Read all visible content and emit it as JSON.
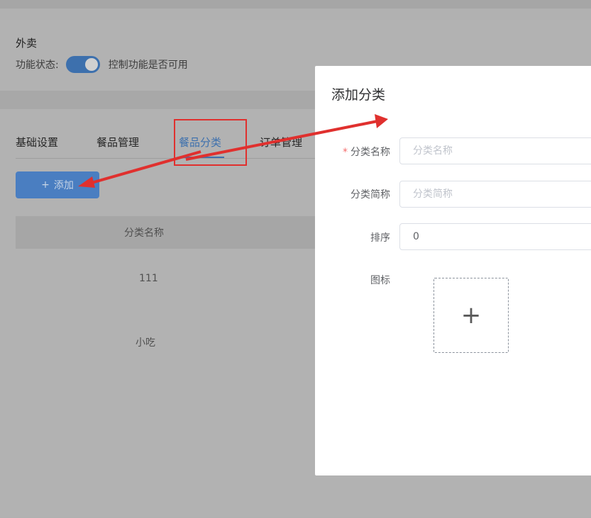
{
  "header": {
    "app_title": "外卖",
    "status_label": "功能状态:",
    "toggle_enabled": true,
    "toggle_hint": "控制功能是否可用"
  },
  "tabs": [
    {
      "label": "基础设置",
      "active": false
    },
    {
      "label": "餐品管理",
      "active": false
    },
    {
      "label": "餐品分类",
      "active": true
    },
    {
      "label": "订单管理",
      "active": false
    }
  ],
  "toolbar": {
    "add_label": "添加",
    "add_icon": "plus-icon"
  },
  "table": {
    "columns": [
      "分类名称"
    ],
    "rows": [
      {
        "name": "111"
      },
      {
        "name": "小吃"
      }
    ]
  },
  "dialog": {
    "title": "添加分类",
    "fields": {
      "name": {
        "label": "分类名称",
        "required": true,
        "value": "",
        "placeholder": "分类名称"
      },
      "short_name": {
        "label": "分类简称",
        "value": "",
        "placeholder": "分类简称"
      },
      "sort": {
        "label": "排序",
        "value": "0"
      },
      "icon": {
        "label": "图标",
        "upload_icon": "plus-icon"
      }
    }
  },
  "annotations": {
    "color": "#e0302e"
  },
  "colors": {
    "primary": "#409eff",
    "danger": "#f56c6c"
  }
}
